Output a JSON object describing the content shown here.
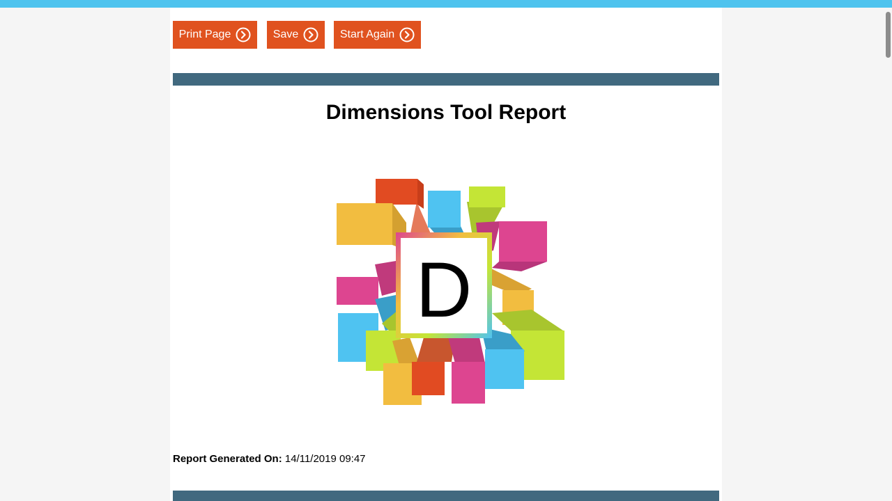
{
  "toolbar": {
    "print_label": "Print Page",
    "save_label": "Save",
    "start_again_label": "Start Again"
  },
  "report": {
    "title": "Dimensions Tool Report",
    "logo_letter": "D",
    "generated_label": "Report Generated On:",
    "generated_value": "14/11/2019 09:47"
  },
  "colors": {
    "accent_button": "#e0521f",
    "band": "#41697f",
    "top_strip": "#4ec3ee",
    "logo_orange": "#e14b22",
    "logo_blue": "#4fc3f1",
    "logo_lime": "#c4e536",
    "logo_yellow": "#f2bd40",
    "logo_pink": "#dd4590"
  },
  "icons": {
    "button_chevron": "chevron-right-circle-icon"
  }
}
